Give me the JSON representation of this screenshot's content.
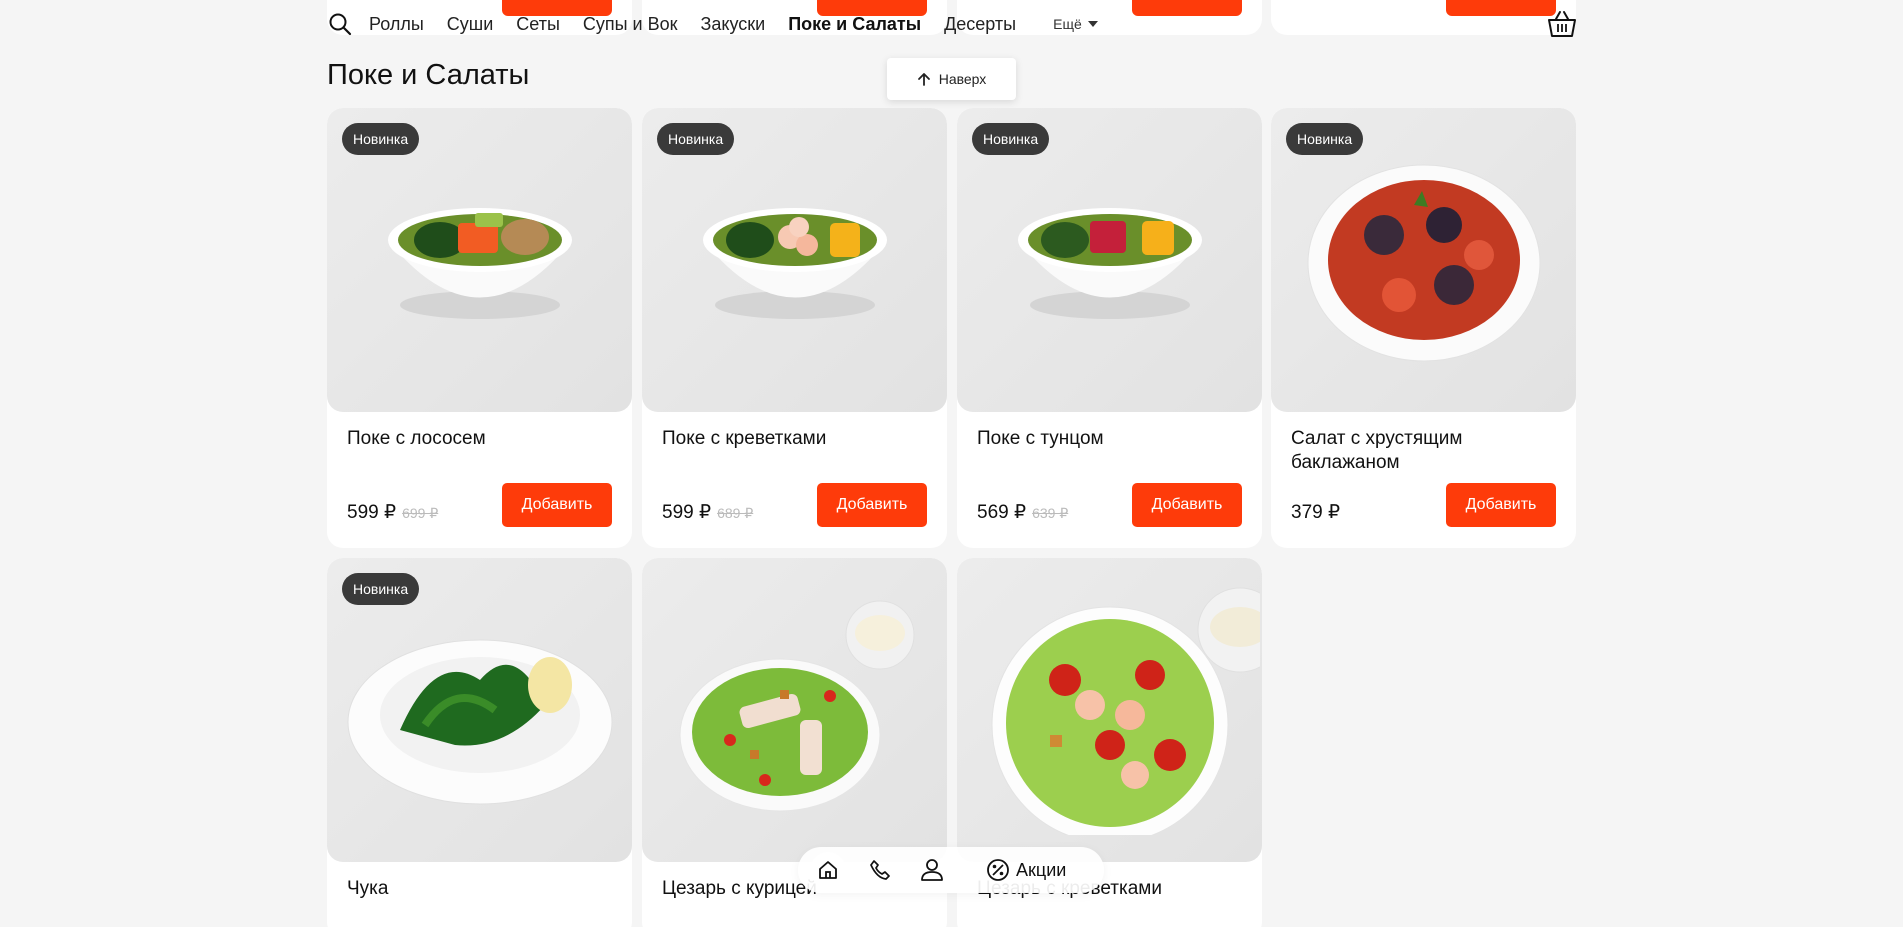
{
  "nav": {
    "items": [
      "Роллы",
      "Суши",
      "Сеты",
      "Супы и Вок",
      "Закуски",
      "Поке и Салаты",
      "Десерты"
    ],
    "active": "Поке и Салаты",
    "more_label": "Ещё"
  },
  "section": {
    "title": "Поке и Салаты"
  },
  "up_button": {
    "label": "Наверх"
  },
  "products": [
    {
      "name": "Поке с лососем",
      "price": "599 ₽",
      "old_price": "699 ₽",
      "badge": "Новинка",
      "add_label": "Добавить"
    },
    {
      "name": "Поке с креветками",
      "price": "599 ₽",
      "old_price": "689 ₽",
      "badge": "Новинка",
      "add_label": "Добавить"
    },
    {
      "name": "Поке с тунцом",
      "price": "569 ₽",
      "old_price": "639 ₽",
      "badge": "Новинка",
      "add_label": "Добавить"
    },
    {
      "name": "Салат с хрустящим баклажаном",
      "price": "379 ₽",
      "old_price": "",
      "badge": "Новинка",
      "add_label": "Добавить"
    },
    {
      "name": "Чука",
      "badge": "Новинка"
    },
    {
      "name": "Цезарь с курицей",
      "badge": ""
    },
    {
      "name": "Цезарь с креветками",
      "badge": ""
    }
  ],
  "bottom_bar": {
    "promo_label": "Акции"
  },
  "colors": {
    "accent": "#fe3b0a",
    "badge_bg": "#3a3a3a",
    "background": "#f5f5f5"
  },
  "icons": [
    "search-icon",
    "cart-icon",
    "arrow-up-icon",
    "home-icon",
    "phone-icon",
    "user-icon",
    "percent-icon",
    "chevron-down-icon"
  ]
}
